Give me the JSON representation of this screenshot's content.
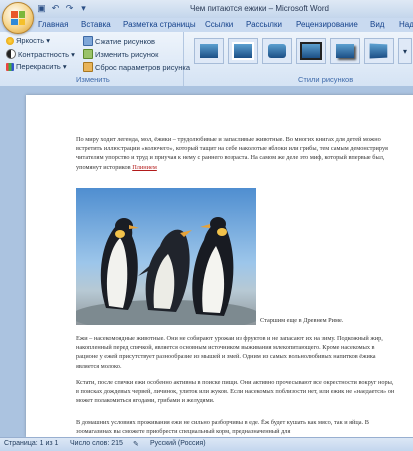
{
  "window": {
    "title": "Чем питаются ежики – Microsoft Word"
  },
  "tabs": [
    "Главная",
    "Вставка",
    "Разметка страницы",
    "Ссылки",
    "Рассылки",
    "Рецензирование",
    "Вид",
    "Над"
  ],
  "ribbon": {
    "group1": {
      "brightness": "Яркость",
      "contrast": "Контрастность",
      "recolor": "Перекрасить",
      "compress": "Сжатие рисунков",
      "change": "Изменить рисунок",
      "reset": "Сброс параметров рисунка",
      "label": "Изменить"
    },
    "group2": {
      "label": "Стили рисунков"
    }
  },
  "document": {
    "p1": "По миру ходит легенда, мол, ёжики – трудолюбивые и запасливые животные.  Во многих книгах для детей можно встретить иллюстрации «колючего», который тащит на себе наколотые яблоки или грибы, тем самым демонстрируя читателям упорство и труд и приучая к нему с раннего возраста. На самом же деле  это миф, который впервые был, упомянут историков",
    "p1_link": "Плинием",
    "caption": "Старшим еще в Древнем Риме.",
    "p2": "Ежи – насекомоядные животные. Они не собирают урожаи из фруктов и не запасают их на зиму. Подкожный жир, накопленный перед спячкой, является основным источником выживания млекопитающего. Кроме насекомых в рационе у ежей присутствует разнообразие из мышей и змей. Одним из самых вольнолюбивых напитков ёжика является молоко.",
    "p3": "Кстати, после спячки ежи особенно активны в поиске пищи. Они активно прочесывают все окрестности вокруг норы, в поисках дождевых червей, личинок, улиток или жуков. Если насекомых поблизости нет, или ежик не «наедается» он может полакомиться ягодами, грибами и желудями.",
    "p4": "В домашних условиях проживания ежи не сильно разборчивы в еде. Ёж будет кушать как мясо, так и яйца. В зоомагазинах вы сможете приобрести специальный корм, предназначенный для"
  },
  "status": {
    "page": "Страница: 1 из 1",
    "words": "Число слов: 215",
    "language": "Русский (Россия)"
  }
}
